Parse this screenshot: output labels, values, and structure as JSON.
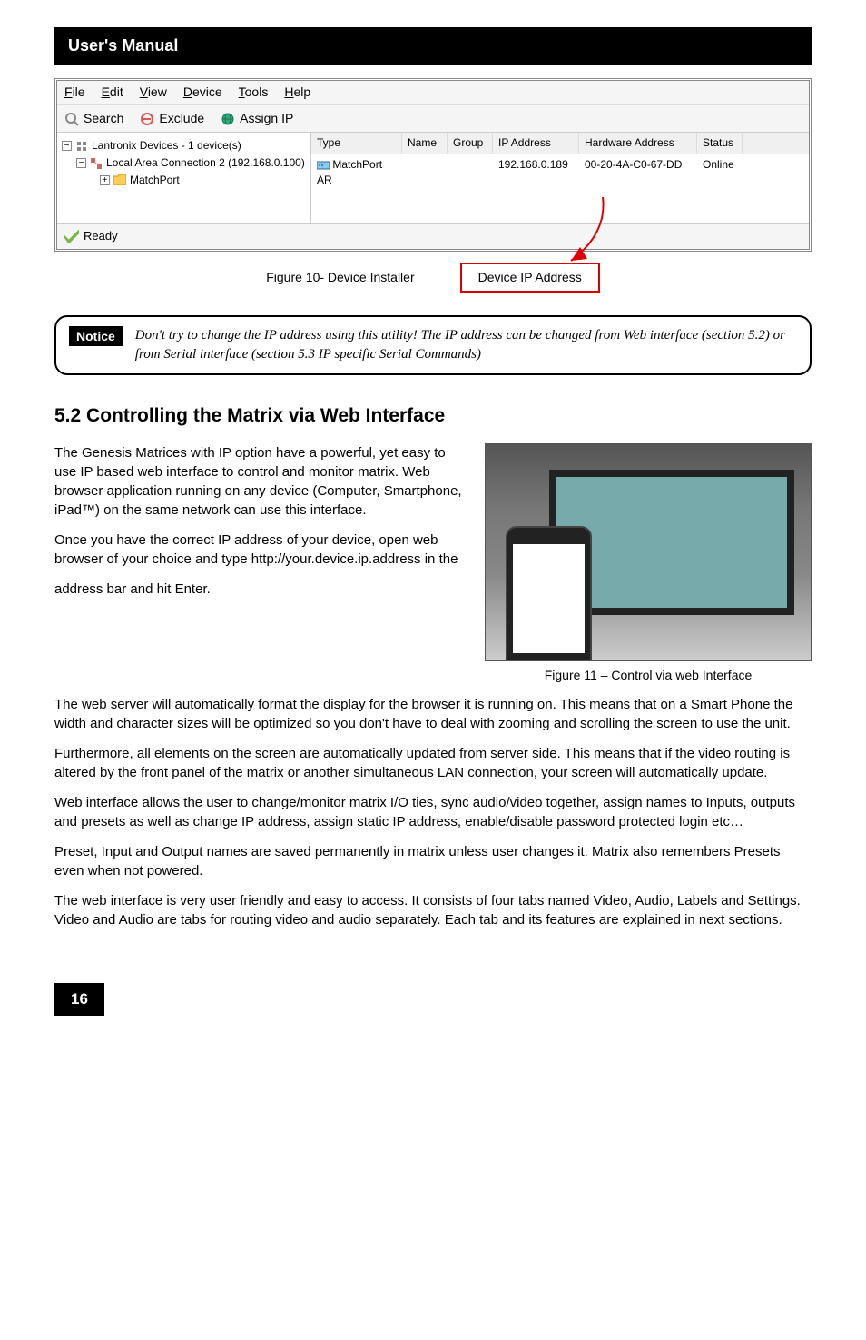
{
  "header": {
    "title": "User's Manual"
  },
  "app": {
    "menubar": {
      "file": "File",
      "edit": "Edit",
      "view": "View",
      "device": "Device",
      "tools": "Tools",
      "help": "Help"
    },
    "toolbar": {
      "search": "Search",
      "exclude": "Exclude",
      "assignip": "Assign IP"
    },
    "tree": {
      "root": "Lantronix Devices - 1 device(s)",
      "conn": "Local Area Connection 2 (192.168.0.100)",
      "device": "MatchPort"
    },
    "list": {
      "headers": {
        "type": "Type",
        "name": "Name",
        "group": "Group",
        "ip": "IP Address",
        "hw": "Hardware Address",
        "status": "Status"
      },
      "row1": {
        "type": "MatchPort AR",
        "name": "",
        "group": "",
        "ip": "192.168.0.189",
        "hw": "00-20-4A-C0-67-DD",
        "status": "Online"
      }
    },
    "statusbar": "Ready"
  },
  "figure10": {
    "caption": "Figure 10- Device Installer",
    "label": "Device IP Address"
  },
  "notice": {
    "label": "Notice",
    "text": "Don't try to change the IP address using this utility! The IP address can be changed from Web interface (section 5.2) or from Serial interface (section 5.3 IP specific Serial Commands)"
  },
  "section": {
    "heading": "5.2 Controlling the Matrix via Web Interface",
    "p1": "The Genesis Matrices with IP option have a powerful, yet easy to use IP based web interface to control and monitor matrix. Web browser application running on any device (Computer, Smartphone, iPad™) on the same network can use this interface.",
    "p2": "Once you have the correct IP address of your device, open web browser of your choice and type http://your.device.ip.address  in the",
    "p3": "address bar and hit Enter.",
    "p4": "The web server will automatically format the display for the browser it is running on. This means that on a Smart Phone the width and character sizes will be optimized so you don't have to deal with zooming and scrolling the screen to use the unit.",
    "p5": "Furthermore, all elements on the screen are automatically updated from server side. This means that if the video routing is altered by the front panel of the matrix or another simultaneous LAN connection, your screen will automatically update.",
    "p6": "Web interface allows the user to change/monitor matrix I/O ties, sync audio/video together, assign names to Inputs, outputs and presets as well as change IP address, assign static IP address, enable/disable password protected login etc…",
    "p7": "Preset, Input and Output names are saved permanently in matrix unless user changes it. Matrix also remembers Presets even when not powered.",
    "p8": "The web interface is very user friendly and easy to access. It consists of four tabs named Video, Audio, Labels and Settings. Video and Audio are tabs for routing video and audio separately. Each tab and its features are explained in next sections."
  },
  "figure11": {
    "caption": "Figure 11 – Control via web Interface"
  },
  "pagenum": "16"
}
